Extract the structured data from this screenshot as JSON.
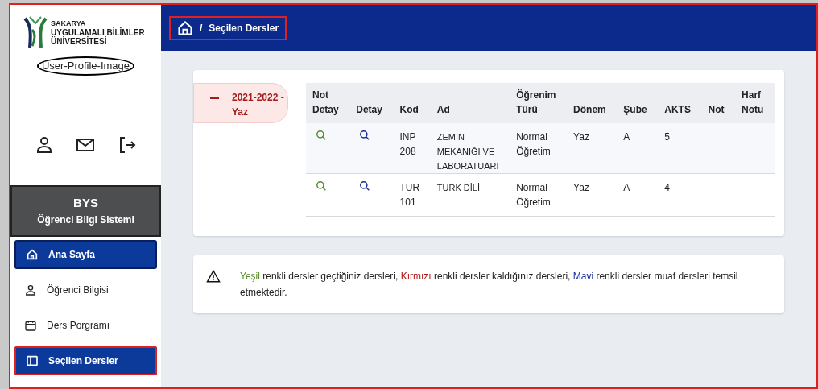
{
  "logo": {
    "lines": [
      "SAKARYA",
      "UYGULAMALI BİLİMLER",
      "ÜNİVERSİTESİ"
    ]
  },
  "profile_image": {
    "alt": "User-Profile-Image"
  },
  "system": {
    "title": "BYS",
    "subtitle": "Öğrenci Bilgi Sistemi"
  },
  "sidebar": {
    "items": [
      {
        "kind": "home",
        "label": "Ana Sayfa",
        "selected": true,
        "highlighted": false
      },
      {
        "kind": "person",
        "label": "Öğrenci Bilgisi",
        "selected": false,
        "highlighted": false
      },
      {
        "kind": "calendar",
        "label": "Ders Porgramı",
        "selected": false,
        "highlighted": false
      },
      {
        "kind": "panel",
        "label": "Seçilen Dersler",
        "selected": true,
        "highlighted": true
      }
    ]
  },
  "breadcrumb": {
    "separator": "/",
    "current": "Seçilen Dersler",
    "highlighted": true
  },
  "term": {
    "label": "2021-2022 - Yaz",
    "expanded": true
  },
  "table": {
    "columns": [
      "Not Detay",
      "Detay",
      "Kod",
      "Ad",
      "Öğrenim Türü",
      "Dönem",
      "Şube",
      "AKTS",
      "Not",
      "Harf Notu"
    ],
    "rows": [
      {
        "code": "INP 208",
        "name": "ZEMİN MEKANİĞİ VE LABORATUARI",
        "type": "Normal Öğretim",
        "term": "Yaz",
        "section": "A",
        "ects": "5"
      },
      {
        "code": "TUR 101",
        "name": "TÜRK DİLİ",
        "type": "Normal Öğretim",
        "term": "Yaz",
        "section": "A",
        "ects": "4"
      }
    ]
  },
  "notice": {
    "segments": [
      {
        "text": "Yeşil",
        "color": "#5a8a2a"
      },
      {
        "text": " renkli dersler geçtiğiniz dersleri, ",
        "color": "#222222"
      },
      {
        "text": "Kırmızı",
        "color": "#b01818"
      },
      {
        "text": " renkli dersler kaldığınız dersleri, ",
        "color": "#222222"
      },
      {
        "text": "Mavi",
        "color": "#1a2a9a"
      },
      {
        "text": " renkli dersler muaf dersleri temsil etmektedir.",
        "color": "#222222"
      }
    ]
  }
}
